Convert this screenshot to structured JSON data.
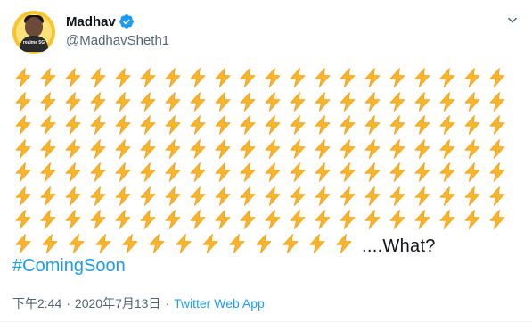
{
  "author": {
    "display_name": "Madhav",
    "handle": "@MadhavSheth1",
    "avatar_brand_text": "realme 5G"
  },
  "tweet": {
    "bolt_rows": [
      20,
      20,
      20,
      20,
      20,
      20,
      20,
      13
    ],
    "bolt_emoji": "lightning-bolt",
    "trailing_text": "....What?",
    "hashtag": "#ComingSoon"
  },
  "meta": {
    "time": "下午2:44",
    "separator": "·",
    "date": "2020年7月13日",
    "source": "Twitter Web App"
  },
  "colors": {
    "accent": "#1d9bf0",
    "bolt_fill": "#f7b52c",
    "bolt_stroke": "#f39c12",
    "verified": "#1d9bf0",
    "secondary_text": "#536471"
  }
}
